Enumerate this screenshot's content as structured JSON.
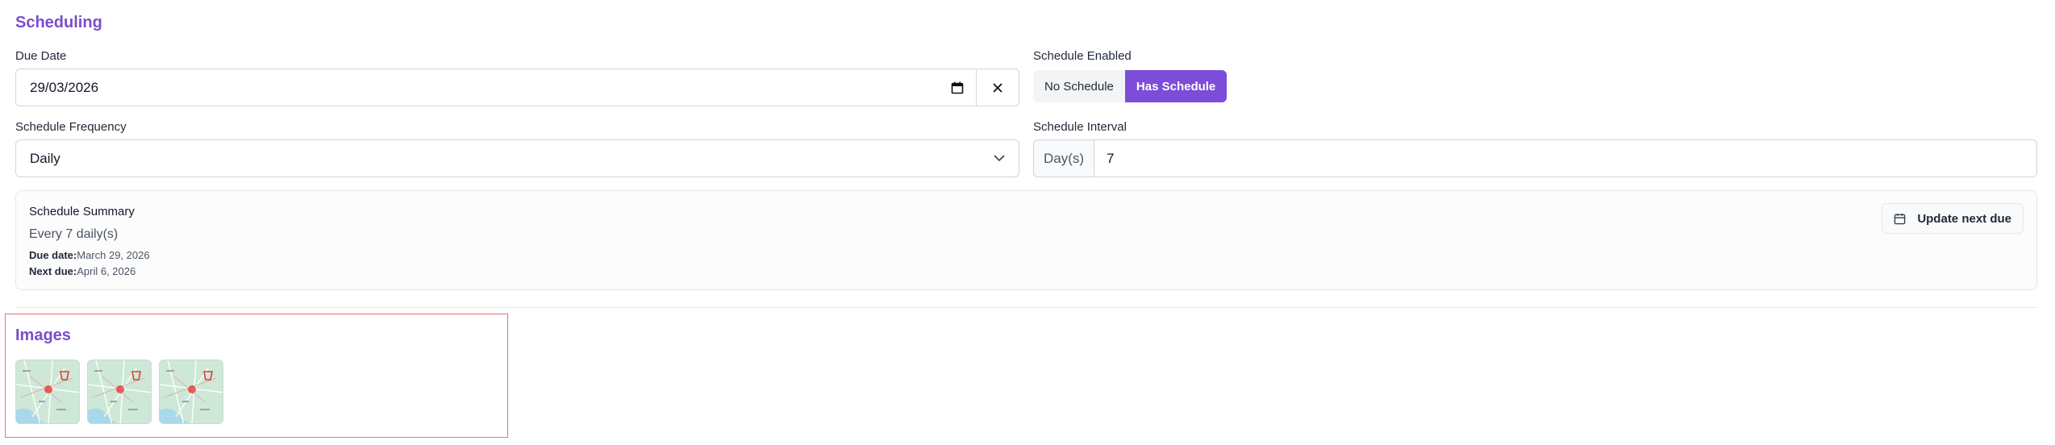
{
  "scheduling": {
    "title": "Scheduling",
    "due_date": {
      "label": "Due Date",
      "value": "29/03/2026"
    },
    "schedule_enabled": {
      "label": "Schedule Enabled",
      "options": [
        "No Schedule",
        "Has Schedule"
      ],
      "selected": "Has Schedule"
    },
    "frequency": {
      "label": "Schedule Frequency",
      "value": "Daily"
    },
    "interval": {
      "label": "Schedule Interval",
      "unit": "Day(s)",
      "value": "7"
    },
    "summary": {
      "title": "Schedule Summary",
      "text": "Every 7 daily(s)",
      "due_label": "Due date:",
      "due_value": "March 29, 2026",
      "next_label": "Next due:",
      "next_value": "April 6, 2026",
      "update_button": "Update next due"
    }
  },
  "images": {
    "title": "Images",
    "thumbnails": [
      {
        "icon": "map-thumbnail"
      },
      {
        "icon": "map-thumbnail"
      },
      {
        "icon": "map-thumbnail"
      }
    ]
  },
  "colors": {
    "accent": "#7c4dd8",
    "highlight_border": "#e57373"
  }
}
